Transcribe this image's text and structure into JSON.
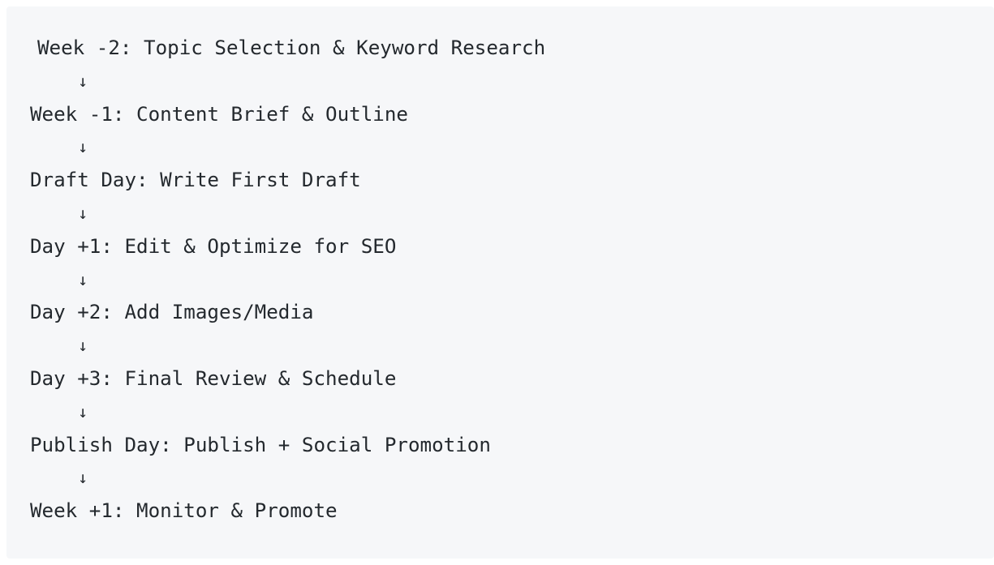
{
  "steps": [
    "Week -2: Topic Selection & Keyword Research",
    "Week -1: Content Brief & Outline",
    "Draft Day: Write First Draft",
    "Day +1: Edit & Optimize for SEO",
    "Day +2: Add Images/Media",
    "Day +3: Final Review & Schedule",
    "Publish Day: Publish + Social Promotion",
    "Week +1: Monitor & Promote"
  ],
  "arrow": "↓"
}
